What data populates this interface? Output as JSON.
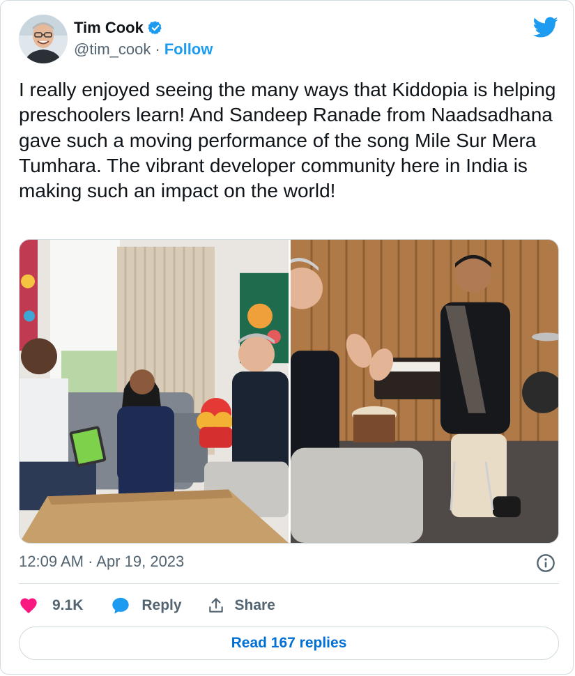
{
  "author": {
    "name": "Tim Cook",
    "handle": "@tim_cook",
    "separator": "·",
    "follow_label": "Follow",
    "verified_icon": "verified-badge-icon",
    "avatar_alt": "avatar"
  },
  "brand": {
    "icon": "twitter-bird-icon",
    "color": "#1d9bf0"
  },
  "tweet": {
    "text": "I really enjoyed seeing the many ways that Kiddopia is helping preschoolers learn! And Sandeep Ranade from Naadsadhana gave such a moving performance of the song Mile Sur Mera Tumhara. The vibrant developer community here in India is making such an impact on the world!",
    "timestamp": "12:09 AM · Apr 19, 2023"
  },
  "actions": {
    "like_count": "9.1K",
    "reply_label": "Reply",
    "share_label": "Share",
    "like_color": "#f91880",
    "reply_color": "#1d9bf0"
  },
  "footer": {
    "read_replies_label": "Read 167 replies",
    "link_color": "#006fd6"
  },
  "colors": {
    "text": "#0f1419",
    "secondary": "#536471",
    "border": "#cfd9de"
  }
}
